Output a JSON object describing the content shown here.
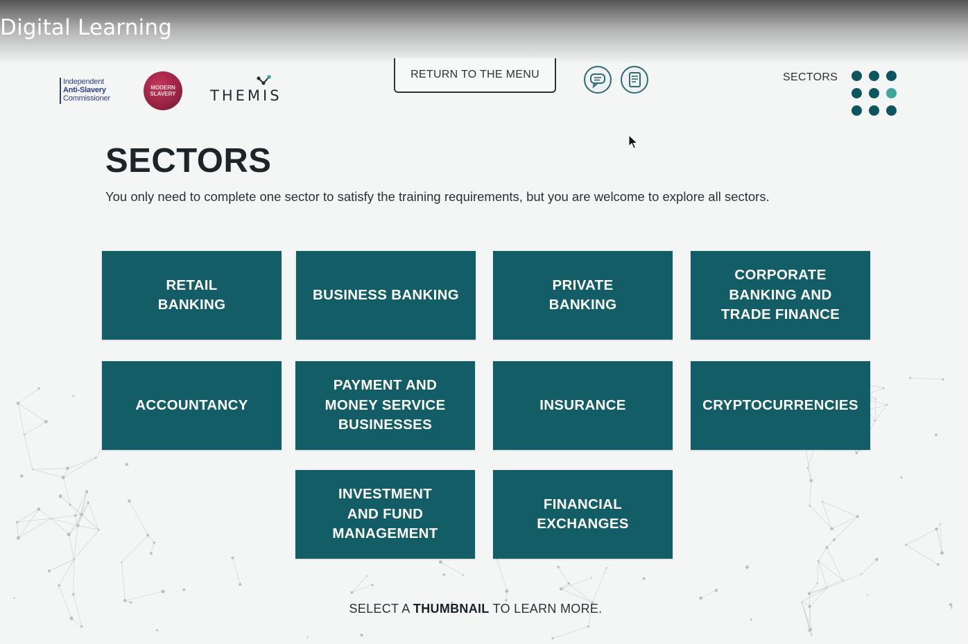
{
  "video": {
    "title": "Digital Learning"
  },
  "logos": {
    "iasc": {
      "line1": "Independent",
      "line2": "Anti-Slavery",
      "line3": "Commissioner"
    },
    "msc": {
      "line1": "MODERN",
      "line2": "SLAVERY"
    },
    "themis": {
      "text": "THEMIS"
    }
  },
  "header": {
    "return_label": "RETURN TO THE MENU",
    "chat_icon": "chat-bubble-icon",
    "notes_icon": "document-icon",
    "sectors_label": "SECTORS",
    "dots_icon": "nine-dot-grid-icon"
  },
  "colors": {
    "tile": "#135d67",
    "accent": "#3fa59a",
    "dark": "#0f5560"
  },
  "page": {
    "title": "SECTORS",
    "subtitle": "You only need to complete one sector to satisfy the training requirements, but you are welcome to explore all sectors."
  },
  "tiles": [
    {
      "label": "RETAIL\nBANKING"
    },
    {
      "label": "BUSINESS BANKING"
    },
    {
      "label": "PRIVATE\nBANKING"
    },
    {
      "label": "CORPORATE\nBANKING AND\nTRADE FINANCE"
    },
    {
      "label": "ACCOUNTANCY"
    },
    {
      "label": "PAYMENT AND\nMONEY SERVICE\nBUSINESSES"
    },
    {
      "label": "INSURANCE"
    },
    {
      "label": "CRYPTOCURRENCIES"
    },
    {
      "label": "INVESTMENT\nAND FUND\nMANAGEMENT"
    },
    {
      "label": "FINANCIAL\nEXCHANGES"
    }
  ],
  "footer": {
    "pre": "SELECT A",
    "bold": "THUMBNAIL",
    "post": "TO LEARN MORE."
  }
}
